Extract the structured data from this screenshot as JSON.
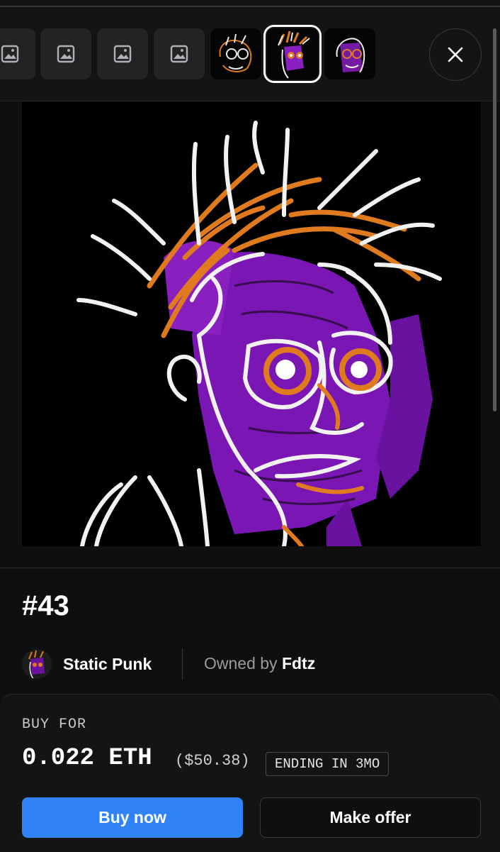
{
  "gallery": {
    "thumbnails": [
      {
        "kind": "placeholder",
        "icon": "image-icon"
      },
      {
        "kind": "placeholder",
        "icon": "image-icon"
      },
      {
        "kind": "placeholder",
        "icon": "image-icon"
      },
      {
        "kind": "placeholder",
        "icon": "image-icon"
      },
      {
        "kind": "artwork",
        "selected": false
      },
      {
        "kind": "artwork",
        "selected": true
      },
      {
        "kind": "artwork",
        "selected": false
      }
    ],
    "close_icon": "close-icon"
  },
  "item": {
    "title": "#43",
    "collection": "Static Punk",
    "owned_by_label": "Owned by",
    "owner": "Fdtz"
  },
  "purchase": {
    "buy_for_label": "BUY FOR",
    "price": "0.022 ETH",
    "usd": "($50.38)",
    "ending": "ENDING IN 3MO",
    "buy_now_label": "Buy now",
    "make_offer_label": "Make offer"
  },
  "colors": {
    "accent": "#2f83f7",
    "art_purple": "#8a1fc0",
    "art_orange": "#e07a1f"
  }
}
